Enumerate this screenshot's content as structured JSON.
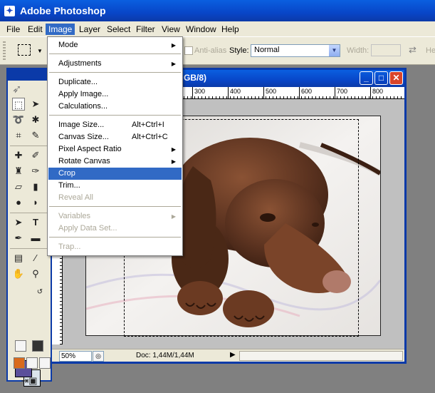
{
  "app": {
    "title": "Adobe Photoshop",
    "icon": "photoshop-icon"
  },
  "menubar": {
    "items": [
      "File",
      "Edit",
      "Image",
      "Layer",
      "Select",
      "Filter",
      "View",
      "Window",
      "Help"
    ],
    "active": "Image"
  },
  "options": {
    "antialias_label": "Anti-alias",
    "style_label": "Style:",
    "style_value": "Normal",
    "width_label": "Width:",
    "height_label": "He"
  },
  "document": {
    "title_visible": "GB/8)",
    "ruler_labels": [
      "300",
      "400",
      "500",
      "600",
      "700",
      "800"
    ],
    "zoom": "50%",
    "info": "Doc: 1,44M/1,44M"
  },
  "image_menu": {
    "items": [
      {
        "label": "Mode",
        "submenu": true
      },
      {
        "label": "Adjustments",
        "submenu": true
      },
      {
        "label": "Duplicate..."
      },
      {
        "label": "Apply Image..."
      },
      {
        "label": "Calculations..."
      },
      {
        "label": "Image Size...",
        "shortcut": "Alt+Ctrl+I"
      },
      {
        "label": "Canvas Size...",
        "shortcut": "Alt+Ctrl+C"
      },
      {
        "label": "Pixel Aspect Ratio",
        "submenu": true
      },
      {
        "label": "Rotate Canvas",
        "submenu": true
      },
      {
        "label": "Crop",
        "highlighted": true
      },
      {
        "label": "Trim..."
      },
      {
        "label": "Reveal All",
        "disabled": true
      },
      {
        "label": "Variables",
        "submenu": true,
        "disabled": true
      },
      {
        "label": "Apply Data Set...",
        "disabled": true
      },
      {
        "label": "Trap...",
        "disabled": true
      }
    ]
  },
  "colors": {
    "foreground": "#5b4f9b",
    "background": "#dbe4ec",
    "highlight": "#316ac5",
    "titlebar": "#0846c8"
  }
}
